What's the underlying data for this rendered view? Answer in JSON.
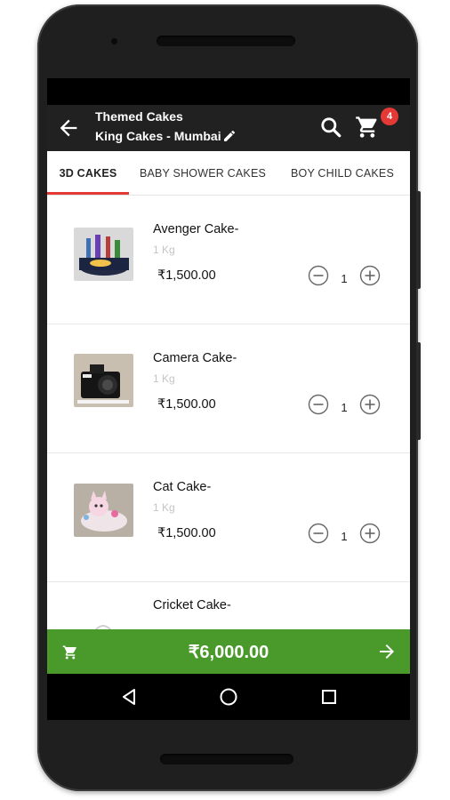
{
  "appbar": {
    "title": "Themed Cakes",
    "subtitle": "King Cakes - Mumbai",
    "cart_count": "4"
  },
  "tabs": [
    {
      "label": "3D CAKES",
      "active": true
    },
    {
      "label": "BABY SHOWER CAKES",
      "active": false
    },
    {
      "label": "BOY CHILD CAKES",
      "active": false
    }
  ],
  "products": [
    {
      "name": "Avenger Cake-",
      "weight": "1 Kg",
      "price": "₹1,500.00",
      "qty": "1"
    },
    {
      "name": "Camera Cake-",
      "weight": "1 Kg",
      "price": "₹1,500.00",
      "qty": "1"
    },
    {
      "name": "Cat Cake-",
      "weight": "1 Kg",
      "price": "₹1,500.00",
      "qty": "1"
    },
    {
      "name": "Cricket Cake-",
      "weight": "",
      "price": "",
      "qty": ""
    }
  ],
  "bottom_bar": {
    "total": "₹6,000.00"
  },
  "colors": {
    "appbar": "#212121",
    "accent": "#e53935",
    "checkout_green": "#4a9a2b"
  },
  "icons": [
    "back-arrow-icon",
    "edit-pencil-icon",
    "search-icon",
    "cart-icon",
    "minus-circle-icon",
    "plus-circle-icon",
    "arrow-right-icon",
    "nav-back-icon",
    "nav-home-icon",
    "nav-recent-icon"
  ]
}
